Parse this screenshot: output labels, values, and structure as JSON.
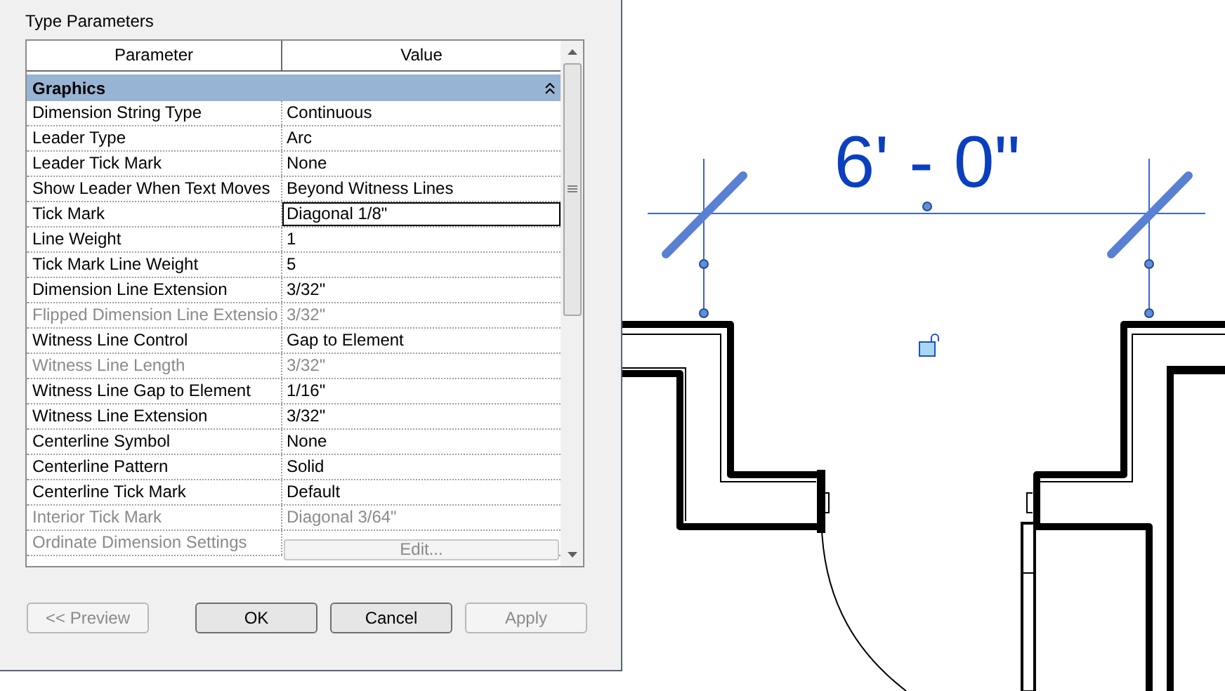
{
  "dialog": {
    "title": "Type Parameters",
    "columns": [
      "Parameter",
      "Value"
    ],
    "group": {
      "label": "Graphics",
      "expanded": true
    },
    "rows": [
      {
        "parameter": "Dimension String Type",
        "value": "Continuous",
        "disabled": false,
        "selected": false,
        "kind": "text"
      },
      {
        "parameter": "Leader Type",
        "value": "Arc",
        "disabled": false,
        "selected": false,
        "kind": "text"
      },
      {
        "parameter": "Leader Tick Mark",
        "value": "None",
        "disabled": false,
        "selected": false,
        "kind": "text"
      },
      {
        "parameter": "Show Leader When Text Moves",
        "value": "Beyond Witness Lines",
        "disabled": false,
        "selected": false,
        "kind": "text"
      },
      {
        "parameter": "Tick Mark",
        "value": "Diagonal 1/8\"",
        "disabled": false,
        "selected": true,
        "kind": "text"
      },
      {
        "parameter": "Line Weight",
        "value": "1",
        "disabled": false,
        "selected": false,
        "kind": "text"
      },
      {
        "parameter": "Tick Mark Line Weight",
        "value": "5",
        "disabled": false,
        "selected": false,
        "kind": "text"
      },
      {
        "parameter": "Dimension Line Extension",
        "value": "3/32\"",
        "disabled": false,
        "selected": false,
        "kind": "text"
      },
      {
        "parameter": "Flipped Dimension Line Extensio",
        "value": "3/32\"",
        "disabled": true,
        "selected": false,
        "kind": "text"
      },
      {
        "parameter": "Witness Line Control",
        "value": "Gap to Element",
        "disabled": false,
        "selected": false,
        "kind": "text"
      },
      {
        "parameter": "Witness Line Length",
        "value": "3/32\"",
        "disabled": true,
        "selected": false,
        "kind": "text"
      },
      {
        "parameter": "Witness Line Gap to Element",
        "value": "1/16\"",
        "disabled": false,
        "selected": false,
        "kind": "text"
      },
      {
        "parameter": "Witness Line Extension",
        "value": "3/32\"",
        "disabled": false,
        "selected": false,
        "kind": "text"
      },
      {
        "parameter": "Centerline Symbol",
        "value": "None",
        "disabled": false,
        "selected": false,
        "kind": "text"
      },
      {
        "parameter": "Centerline Pattern",
        "value": "Solid",
        "disabled": false,
        "selected": false,
        "kind": "text"
      },
      {
        "parameter": "Centerline Tick Mark",
        "value": "Default",
        "disabled": false,
        "selected": false,
        "kind": "text"
      },
      {
        "parameter": "Interior Tick Mark",
        "value": "Diagonal 3/64\"",
        "disabled": true,
        "selected": false,
        "kind": "text"
      },
      {
        "parameter": "Ordinate Dimension Settings",
        "value": "Edit...",
        "disabled": true,
        "selected": false,
        "kind": "button"
      }
    ],
    "buttons": [
      {
        "label": "<< Preview",
        "disabled": true
      },
      {
        "label": "OK",
        "disabled": false
      },
      {
        "label": "Cancel",
        "disabled": false
      },
      {
        "label": "Apply",
        "disabled": true
      }
    ]
  },
  "canvas": {
    "dimension_text": "6' - 0\""
  }
}
